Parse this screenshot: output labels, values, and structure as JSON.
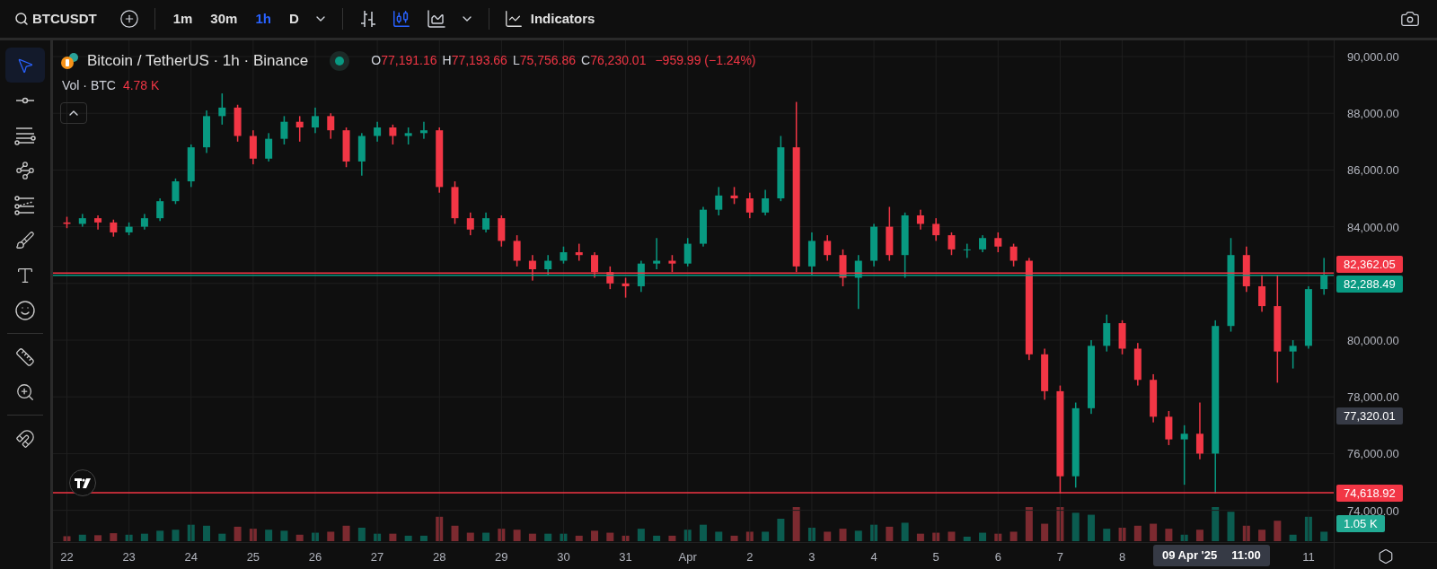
{
  "toolbar": {
    "symbol": "BTCUSDT",
    "intervals": [
      {
        "label": "1m",
        "selected": false
      },
      {
        "label": "30m",
        "selected": false
      },
      {
        "label": "1h",
        "selected": true
      },
      {
        "label": "D",
        "selected": false
      }
    ],
    "chart_types": [
      {
        "kind": "bars",
        "selected": false
      },
      {
        "kind": "candles",
        "selected": true
      },
      {
        "kind": "area",
        "selected": false
      }
    ],
    "indicators_label": "Indicators"
  },
  "drawing_tools": [
    [
      {
        "kind": "cursor",
        "selected": true
      },
      {
        "kind": "trend-line",
        "selected": false
      },
      {
        "kind": "fib",
        "selected": false
      },
      {
        "kind": "pattern",
        "selected": false
      },
      {
        "kind": "projection",
        "selected": false
      },
      {
        "kind": "brush",
        "selected": false
      },
      {
        "kind": "text",
        "selected": false
      },
      {
        "kind": "emoji",
        "selected": false
      }
    ],
    [
      {
        "kind": "ruler",
        "selected": false
      },
      {
        "kind": "zoom",
        "selected": false
      }
    ],
    [
      {
        "kind": "magnet",
        "selected": false
      }
    ]
  ],
  "legend": {
    "title": "Bitcoin / TetherUS · 1h · Binance",
    "ohlc": [
      {
        "key": "O",
        "value": "77,191.16"
      },
      {
        "key": "H",
        "value": "77,193.66"
      },
      {
        "key": "L",
        "value": "75,756.86"
      },
      {
        "key": "C",
        "value": "76,230.01"
      }
    ],
    "change": "−959.99 (−1.24%)",
    "volume_label": "Vol · BTC",
    "volume_value": "4.78 K"
  },
  "chart": {
    "chart_data": {
      "type": "candlestick",
      "grid": true,
      "xlim": [
        "2025-03-21 18:37",
        "2025-04-13 01:41"
      ],
      "ylim": [
        72880,
        90570
      ],
      "ref_lines": [
        {
          "axis": "y",
          "value": 82362.05,
          "color": "#f23645"
        },
        {
          "axis": "y",
          "value": 82288.49,
          "color": "#089981"
        },
        {
          "axis": "y",
          "value": 74618.92,
          "color": "#f23645"
        }
      ],
      "x": [
        "2025-03-22 00:00",
        "2025-03-22 06:00",
        "2025-03-22 12:00",
        "2025-03-22 18:00",
        "2025-03-23 00:00",
        "2025-03-23 06:00",
        "2025-03-23 12:00",
        "2025-03-23 18:00",
        "2025-03-24 00:00",
        "2025-03-24 06:00",
        "2025-03-24 12:00",
        "2025-03-24 18:00",
        "2025-03-25 00:00",
        "2025-03-25 06:00",
        "2025-03-25 12:00",
        "2025-03-25 18:00",
        "2025-03-26 00:00",
        "2025-03-26 06:00",
        "2025-03-26 12:00",
        "2025-03-26 18:00",
        "2025-03-27 00:00",
        "2025-03-27 06:00",
        "2025-03-27 12:00",
        "2025-03-27 18:00",
        "2025-03-28 00:00",
        "2025-03-28 06:00",
        "2025-03-28 12:00",
        "2025-03-28 18:00",
        "2025-03-29 00:00",
        "2025-03-29 06:00",
        "2025-03-29 12:00",
        "2025-03-29 18:00",
        "2025-03-30 00:00",
        "2025-03-30 06:00",
        "2025-03-30 12:00",
        "2025-03-30 18:00",
        "2025-03-31 00:00",
        "2025-03-31 06:00",
        "2025-03-31 12:00",
        "2025-03-31 18:00",
        "2025-04-01 00:00",
        "2025-04-01 06:00",
        "2025-04-01 12:00",
        "2025-04-01 18:00",
        "2025-04-02 00:00",
        "2025-04-02 06:00",
        "2025-04-02 12:00",
        "2025-04-02 18:00",
        "2025-04-03 00:00",
        "2025-04-03 06:00",
        "2025-04-03 12:00",
        "2025-04-03 18:00",
        "2025-04-04 00:00",
        "2025-04-04 06:00",
        "2025-04-04 12:00",
        "2025-04-04 18:00",
        "2025-04-05 00:00",
        "2025-04-05 06:00",
        "2025-04-05 12:00",
        "2025-04-05 18:00",
        "2025-04-06 00:00",
        "2025-04-06 06:00",
        "2025-04-06 12:00",
        "2025-04-06 18:00",
        "2025-04-07 00:00",
        "2025-04-07 06:00",
        "2025-04-07 12:00",
        "2025-04-07 18:00",
        "2025-04-08 00:00",
        "2025-04-08 06:00",
        "2025-04-08 12:00",
        "2025-04-08 18:00",
        "2025-04-09 00:00",
        "2025-04-09 06:00",
        "2025-04-09 12:00",
        "2025-04-09 18:00",
        "2025-04-10 00:00",
        "2025-04-10 06:00",
        "2025-04-10 12:00",
        "2025-04-10 18:00",
        "2025-04-11 00:00",
        "2025-04-11 06:00"
      ],
      "ohlc": [
        [
          84150,
          84350,
          83950,
          84100
        ],
        [
          84100,
          84450,
          84000,
          84300
        ],
        [
          84300,
          84400,
          83900,
          84150
        ],
        [
          84150,
          84250,
          83650,
          83800
        ],
        [
          83800,
          84150,
          83700,
          84000
        ],
        [
          84000,
          84450,
          83900,
          84300
        ],
        [
          84300,
          85000,
          84200,
          84900
        ],
        [
          84900,
          85700,
          84800,
          85600
        ],
        [
          85600,
          86900,
          85400,
          86800
        ],
        [
          86800,
          88100,
          86600,
          87900
        ],
        [
          87900,
          88700,
          87600,
          88200
        ],
        [
          88200,
          88300,
          87000,
          87200
        ],
        [
          87200,
          87400,
          86200,
          86400
        ],
        [
          86400,
          87300,
          86300,
          87100
        ],
        [
          87100,
          87900,
          86900,
          87700
        ],
        [
          87700,
          87900,
          87000,
          87500
        ],
        [
          87500,
          88200,
          87300,
          87900
        ],
        [
          87900,
          88000,
          87100,
          87400
        ],
        [
          87400,
          87500,
          86100,
          86300
        ],
        [
          86300,
          87300,
          85800,
          87200
        ],
        [
          87200,
          87700,
          87000,
          87500
        ],
        [
          87500,
          87600,
          86900,
          87200
        ],
        [
          87200,
          87500,
          86900,
          87300
        ],
        [
          87300,
          87700,
          87100,
          87400
        ],
        [
          87400,
          87500,
          85200,
          85400
        ],
        [
          85400,
          85600,
          84100,
          84300
        ],
        [
          84300,
          84500,
          83700,
          83900
        ],
        [
          83900,
          84500,
          83800,
          84300
        ],
        [
          84300,
          84400,
          83300,
          83500
        ],
        [
          83500,
          83700,
          82600,
          82800
        ],
        [
          82800,
          83000,
          82100,
          82500
        ],
        [
          82500,
          83000,
          82300,
          82800
        ],
        [
          82800,
          83300,
          82700,
          83100
        ],
        [
          83100,
          83400,
          82800,
          83000
        ],
        [
          83000,
          83100,
          82200,
          82400
        ],
        [
          82400,
          82600,
          81800,
          82000
        ],
        [
          82000,
          82200,
          81500,
          81900
        ],
        [
          81900,
          82800,
          81700,
          82700
        ],
        [
          82700,
          83600,
          82500,
          82800
        ],
        [
          82800,
          83000,
          82400,
          82700
        ],
        [
          82700,
          83600,
          82600,
          83400
        ],
        [
          83400,
          84700,
          83300,
          84600
        ],
        [
          84600,
          85400,
          84400,
          85100
        ],
        [
          85100,
          85400,
          84800,
          85000
        ],
        [
          85000,
          85200,
          84300,
          84500
        ],
        [
          84500,
          85300,
          84400,
          85000
        ],
        [
          85000,
          87200,
          84900,
          86800
        ],
        [
          86800,
          88400,
          82400,
          82600
        ],
        [
          82600,
          83800,
          82300,
          83500
        ],
        [
          83500,
          83700,
          82800,
          83000
        ],
        [
          83000,
          83200,
          81900,
          82200
        ],
        [
          82200,
          83000,
          81100,
          82800
        ],
        [
          82800,
          84100,
          82600,
          84000
        ],
        [
          84000,
          84700,
          82800,
          83000
        ],
        [
          83000,
          84500,
          82200,
          84400
        ],
        [
          84400,
          84600,
          83900,
          84100
        ],
        [
          84100,
          84300,
          83500,
          83700
        ],
        [
          83700,
          83800,
          83000,
          83200
        ],
        [
          83200,
          83400,
          82900,
          83200
        ],
        [
          83200,
          83700,
          83100,
          83600
        ],
        [
          83600,
          83800,
          83100,
          83300
        ],
        [
          83300,
          83400,
          82600,
          82800
        ],
        [
          82800,
          82900,
          79300,
          79500
        ],
        [
          79500,
          79700,
          77900,
          78200
        ],
        [
          78200,
          78400,
          74600,
          75200
        ],
        [
          75200,
          77800,
          74800,
          77600
        ],
        [
          77600,
          80000,
          77400,
          79800
        ],
        [
          79800,
          80900,
          79600,
          80600
        ],
        [
          80600,
          80700,
          79500,
          79700
        ],
        [
          79700,
          79900,
          78400,
          78600
        ],
        [
          78600,
          78800,
          77100,
          77300
        ],
        [
          77300,
          77500,
          76300,
          76500
        ],
        [
          76500,
          77000,
          74900,
          76700
        ],
        [
          76700,
          77800,
          75800,
          76000
        ],
        [
          76000,
          80700,
          74600,
          80500
        ],
        [
          80500,
          83600,
          80300,
          83000
        ],
        [
          83000,
          83300,
          81700,
          81900
        ],
        [
          81900,
          82300,
          81000,
          81200
        ],
        [
          81200,
          82300,
          78500,
          79600
        ],
        [
          79600,
          80000,
          79000,
          79800
        ],
        [
          79800,
          81900,
          79700,
          81800
        ],
        [
          81800,
          82900,
          81600,
          82300
        ]
      ],
      "yticks": [
        {
          "value": 90000,
          "label": "90,000.00"
        },
        {
          "value": 88000,
          "label": "88,000.00"
        },
        {
          "value": 86000,
          "label": "86,000.00"
        },
        {
          "value": 84000,
          "label": "84,000.00"
        },
        {
          "value": 80000,
          "label": "80,000.00"
        },
        {
          "value": 78000,
          "label": "78,000.00"
        },
        {
          "value": 76000,
          "label": "76,000.00"
        },
        {
          "value": 74000,
          "label": "74,000.00"
        }
      ],
      "xticks": [
        {
          "value": "2025-03-22",
          "label": "22"
        },
        {
          "value": "2025-03-23",
          "label": "23"
        },
        {
          "value": "2025-03-24",
          "label": "24"
        },
        {
          "value": "2025-03-25",
          "label": "25"
        },
        {
          "value": "2025-03-26",
          "label": "26"
        },
        {
          "value": "2025-03-27",
          "label": "27"
        },
        {
          "value": "2025-03-28",
          "label": "28"
        },
        {
          "value": "2025-03-29",
          "label": "29"
        },
        {
          "value": "2025-03-30",
          "label": "30"
        },
        {
          "value": "2025-03-31",
          "label": "31"
        },
        {
          "value": "2025-04-01",
          "label": "Apr"
        },
        {
          "value": "2025-04-02",
          "label": "2"
        },
        {
          "value": "2025-04-03",
          "label": "3"
        },
        {
          "value": "2025-04-04",
          "label": "4"
        },
        {
          "value": "2025-04-05",
          "label": "5"
        },
        {
          "value": "2025-04-06",
          "label": "6"
        },
        {
          "value": "2025-04-07",
          "label": "7"
        },
        {
          "value": "2025-04-08",
          "label": "8"
        },
        {
          "value": "2025-04-11",
          "label": "11"
        }
      ]
    },
    "markers": [
      {
        "value": "82,362.05",
        "color": "#f23645"
      },
      {
        "value": "82,288.49",
        "color": "#089981"
      },
      {
        "value": "77,320.01",
        "color": "#363a45"
      },
      {
        "value": "74,618.92",
        "color": "#f23645"
      },
      {
        "value": "1.05 K",
        "color": "#22ab94"
      }
    ],
    "crosshair_date": "09 Apr '25",
    "crosshair_time": "11:00"
  }
}
